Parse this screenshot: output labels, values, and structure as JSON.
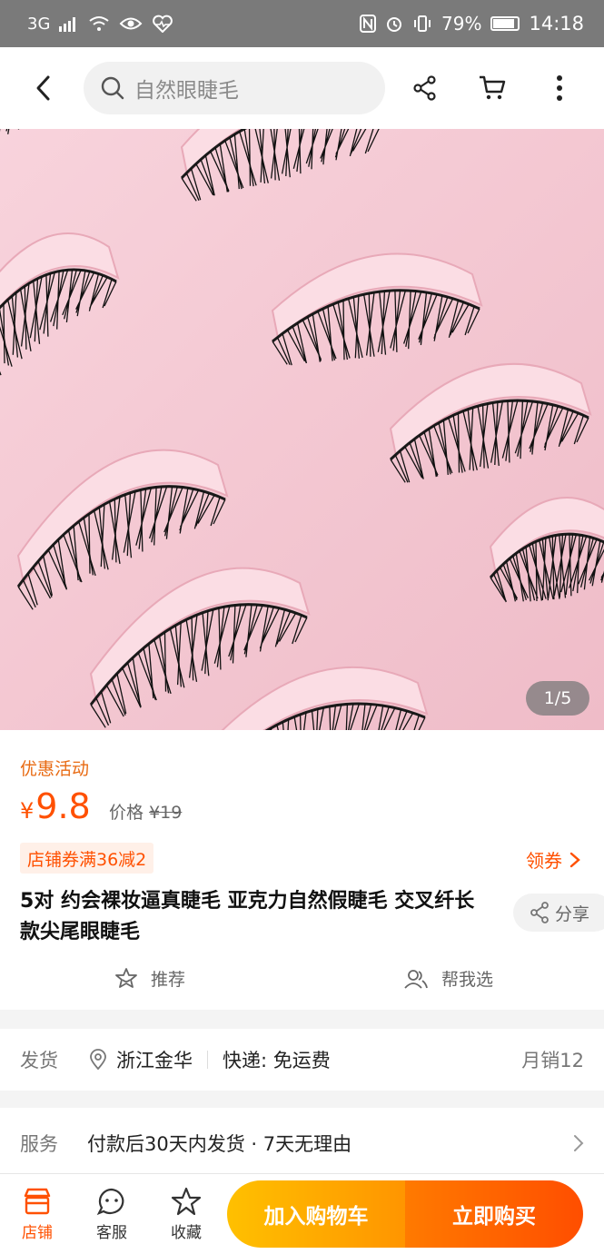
{
  "status_bar": {
    "network": "3G",
    "battery": "79%",
    "battery_level": 0.79,
    "time": "14:18"
  },
  "topnav": {
    "search_placeholder": "自然眼睫毛",
    "icons": [
      "back-icon",
      "search-icon",
      "share-icon",
      "cart-icon",
      "more-icon"
    ]
  },
  "hero": {
    "pager": "1/5"
  },
  "product": {
    "promo_label": "优惠活动",
    "currency": "¥",
    "price": "9.8",
    "orig_label": "价格",
    "orig_price": "¥19",
    "coupon": "店铺券满36减2",
    "get_coupon": "领券",
    "title": "5对 约会裸妆逼真睫毛 亚克力自然假睫毛 交叉纤长款尖尾眼睫毛",
    "share": "分享",
    "recommend": "推荐",
    "help_choose": "帮我选"
  },
  "shipping": {
    "label": "发货",
    "location": "浙江金华",
    "express": "快递: 免运费",
    "monthly_sales": "月销12"
  },
  "service": {
    "label": "服务",
    "text": "付款后30天内发货 · 7天无理由"
  },
  "bottom_bar": {
    "shop": "店铺",
    "customer_service": "客服",
    "favorite": "收藏",
    "add_to_cart": "加入购物车",
    "buy_now": "立即购买"
  },
  "colors": {
    "accent": "#ff5000",
    "cart_gradient": [
      "#ffc000",
      "#ff9500"
    ],
    "buy_gradient": [
      "#ff7a00",
      "#ff4e00"
    ]
  }
}
